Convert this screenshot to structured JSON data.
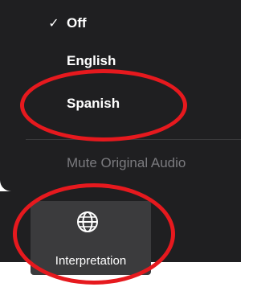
{
  "menu": {
    "items": [
      {
        "label": "Off",
        "checked": true,
        "check_glyph": "✓"
      },
      {
        "label": "English",
        "checked": false
      },
      {
        "label": "Spanish",
        "checked": false
      }
    ],
    "mute_label": "Mute Original Audio"
  },
  "toolbar": {
    "interpretation_label": "Interpretation",
    "interpretation_icon": "globe-icon"
  },
  "colors": {
    "menu_bg": "#1f1f21",
    "button_bg": "#3b3b3d",
    "disabled_text": "#7b7b7f",
    "annotation": "#e6191e"
  }
}
